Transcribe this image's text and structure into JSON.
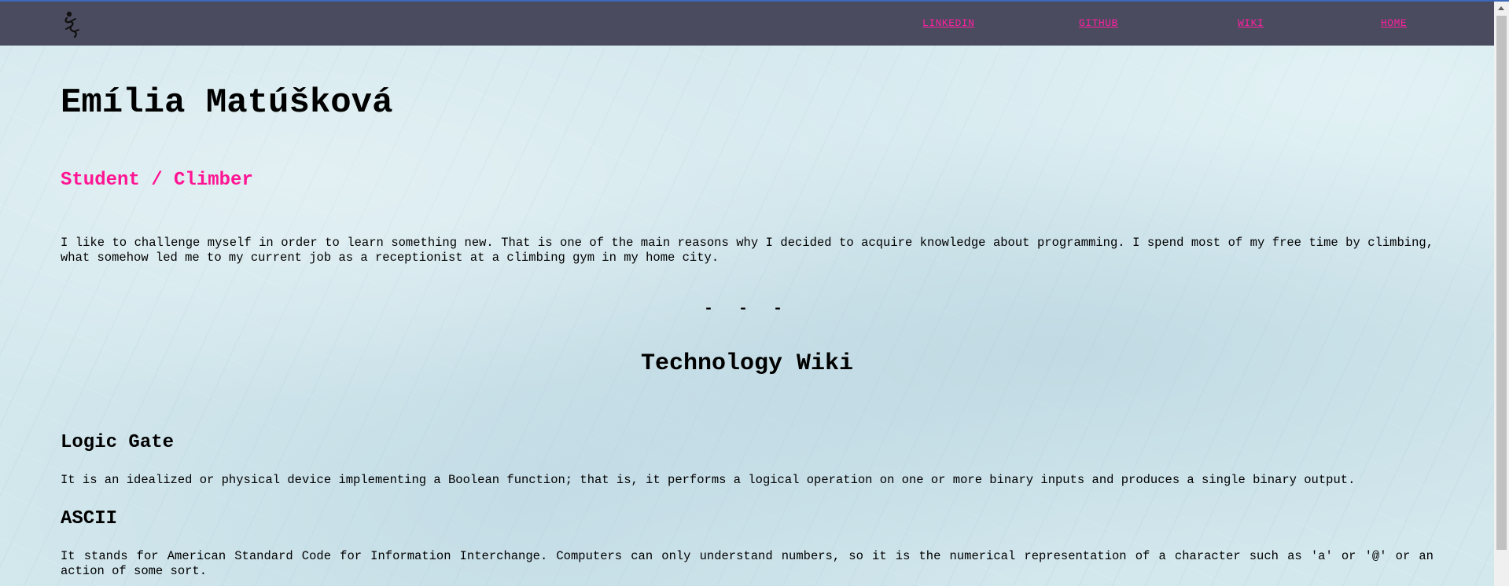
{
  "nav": {
    "links": [
      {
        "label": "LINKEDIN"
      },
      {
        "label": "GITHUB"
      },
      {
        "label": "WIKI"
      },
      {
        "label": "HOME"
      }
    ]
  },
  "profile": {
    "name": "Emília Matúšková",
    "subtitle": "Student / Climber",
    "intro": "I like to challenge myself in order to learn something new. That is one of the main reasons why I decided to acquire knowledge about programming. I spend most of my free time by climbing, what somehow led me to my current job as a receptionist at a climbing gym in my home city."
  },
  "divider": "- - -",
  "wiki": {
    "title": "Technology Wiki",
    "sections": [
      {
        "heading": "Logic Gate",
        "text": "It is an idealized or physical device implementing a Boolean function; that is, it performs a logical operation on one or more binary inputs and produces a single binary output."
      },
      {
        "heading": "ASCII",
        "text": "It stands for American Standard Code for Information Interchange. Computers can only understand numbers, so it is the numerical representation of a character such as 'a' or '@' or an action of some sort."
      }
    ]
  },
  "colors": {
    "navbar": "#4b4b5f",
    "accent": "#ff1493",
    "background": "#d3e8ed"
  },
  "icons": {
    "logo": "climber-logo-icon"
  }
}
